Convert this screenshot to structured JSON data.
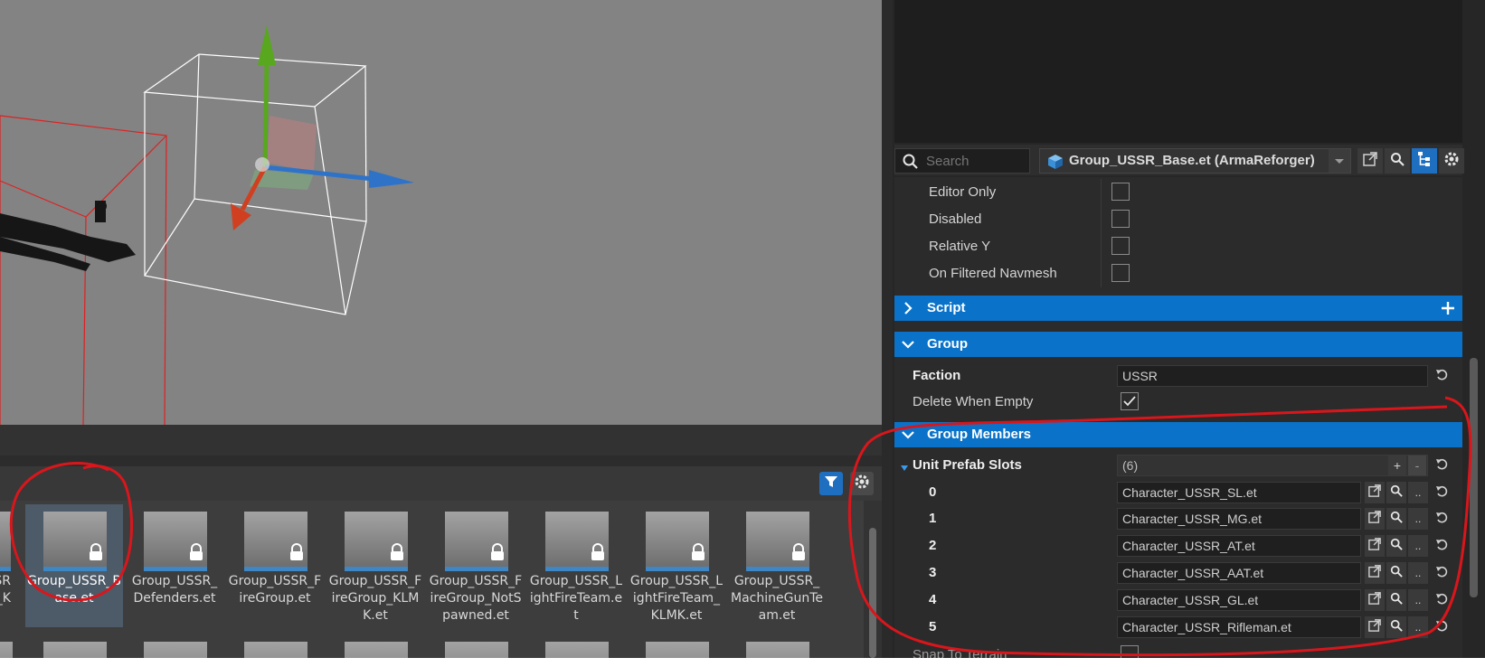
{
  "browser": {
    "assets": [
      {
        "label": "Group_USSR_Base.et",
        "selected": true
      },
      {
        "label": "Group_USSR_Defenders.et",
        "selected": false
      },
      {
        "label": "Group_USSR_FireGroup.et",
        "selected": false
      },
      {
        "label": "Group_USSR_FireGroup_KLMK.et",
        "selected": false
      },
      {
        "label": "Group_USSR_FireGroup_NotSpawned.et",
        "selected": false
      },
      {
        "label": "Group_USSR_LightFireTeam.et",
        "selected": false
      },
      {
        "label": "Group_USSR_LightFireTeam_KLMK.et",
        "selected": false
      },
      {
        "label": "Group_USSR_MachineGunTeam.et",
        "selected": false
      }
    ],
    "partial_left_labels": [
      "SR",
      "n_K"
    ],
    "icons": {
      "filter": "filter-icon",
      "settings": "gear-icon",
      "lock": "lock-icon"
    },
    "colors": {
      "filter_active": "#1f6fc0",
      "selected_tile": "#4d5a68",
      "strip": "#3f86c4"
    }
  },
  "inspector": {
    "search_placeholder": "Search",
    "entity_combo": "Group_USSR_Base.et (ArmaReforger)",
    "toolbar_icons": [
      "open-external-icon",
      "search-icon",
      "hierarchy-icon",
      "gear-icon"
    ],
    "flags": [
      {
        "label": "Editor Only",
        "checked": false
      },
      {
        "label": "Disabled",
        "checked": false
      },
      {
        "label": "Relative Y",
        "checked": false
      },
      {
        "label": "On Filtered Navmesh",
        "checked": false
      }
    ],
    "sections": {
      "script": "Script",
      "group": "Group",
      "group_members": "Group Members"
    },
    "group": {
      "faction_label": "Faction",
      "faction_value": "USSR",
      "delete_when_empty_label": "Delete When Empty",
      "delete_when_empty": true
    },
    "members": {
      "slots_label": "Unit Prefab Slots",
      "slots_count": "(6)",
      "add_label": "+",
      "remove_label": "-",
      "slots": [
        {
          "index": "0",
          "value": "Character_USSR_SL.et"
        },
        {
          "index": "1",
          "value": "Character_USSR_MG.et"
        },
        {
          "index": "2",
          "value": "Character_USSR_AT.et"
        },
        {
          "index": "3",
          "value": "Character_USSR_AAT.et"
        },
        {
          "index": "4",
          "value": "Character_USSR_GL.et"
        },
        {
          "index": "5",
          "value": "Character_USSR_Rifleman.et"
        }
      ],
      "ellipsis_label": ".."
    },
    "partial_bottom_label": "Snap To Terrain"
  },
  "colors": {
    "section_blue": "#0a73c9",
    "annotation_red": "#d9161c",
    "viewport_grey": "#838383"
  }
}
